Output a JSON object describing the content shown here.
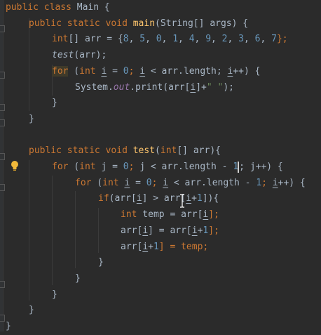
{
  "editor": {
    "lines": [
      [
        "public",
        " ",
        "class",
        " Main {"
      ],
      [
        "public",
        " ",
        "static",
        " ",
        "void",
        " ",
        "main",
        "(String[] args) {"
      ],
      [
        "int",
        "[] arr = {",
        "8",
        ", ",
        "5",
        ", ",
        "0",
        ", ",
        "1",
        ", ",
        "4",
        ", ",
        "9",
        ", ",
        "2",
        ", ",
        "3",
        ", ",
        "6",
        ", ",
        "7",
        "};"
      ],
      [
        "test",
        "(arr);"
      ],
      [
        "for",
        " (",
        "int",
        " ",
        "i",
        " = ",
        "0",
        "; ",
        "i",
        " < arr.length; ",
        "i",
        "++) {"
      ],
      [
        "System.",
        "out",
        ".print(arr[",
        "i",
        "]+",
        "\" \"",
        ");"
      ],
      [
        "}"
      ],
      [
        "}"
      ],
      [],
      [
        "public",
        " ",
        "static",
        " ",
        "void",
        " ",
        "test",
        "(",
        "int",
        "[] arr){"
      ],
      [
        "for",
        " (",
        "int",
        " ",
        "j",
        " = ",
        "0",
        "; ",
        "j",
        " < arr.length - ",
        "1",
        "; j++) {"
      ],
      [
        "for",
        " (",
        "int",
        " ",
        "i",
        " = ",
        "0",
        "; ",
        "i",
        " < arr.length - ",
        "1",
        "; ",
        "i",
        "++) {"
      ],
      [
        "if",
        "(arr[",
        "i",
        "] > arr[",
        "i",
        "+",
        "1",
        "]){"
      ],
      [
        "int",
        " temp = arr[",
        "i",
        "];"
      ],
      [
        "arr[",
        "i",
        "] = arr[",
        "i",
        "+",
        "1",
        "];"
      ],
      [
        "arr[",
        "i",
        "+",
        "1",
        "] = temp;"
      ],
      [
        "}"
      ],
      [
        "}"
      ],
      [
        "}"
      ],
      [
        "}"
      ]
    ]
  },
  "icons": {
    "intention_bulb": "lightbulb-icon",
    "mouse_cursor": "text-cursor-icon"
  },
  "colors": {
    "background": "#2b2b2b",
    "text": "#a9b7c6",
    "keyword": "#cc7832",
    "function": "#ffc66d",
    "number": "#6897bb",
    "string": "#6a8759",
    "static_field": "#9876aa"
  }
}
